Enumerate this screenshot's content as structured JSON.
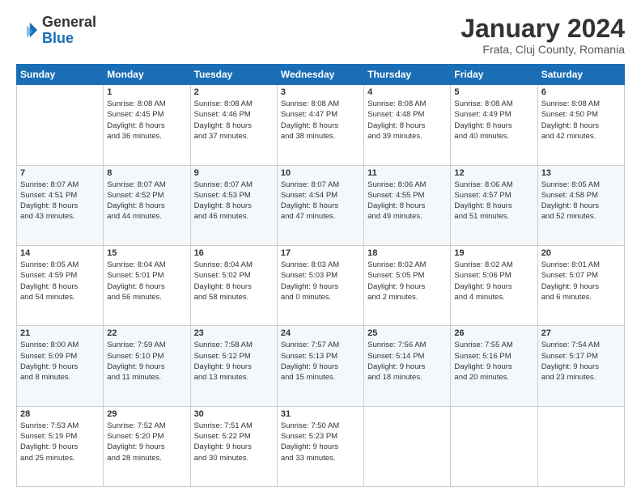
{
  "logo": {
    "line1": "General",
    "line2": "Blue"
  },
  "title": "January 2024",
  "subtitle": "Frata, Cluj County, Romania",
  "days_header": [
    "Sunday",
    "Monday",
    "Tuesday",
    "Wednesday",
    "Thursday",
    "Friday",
    "Saturday"
  ],
  "weeks": [
    [
      {
        "day": "",
        "content": ""
      },
      {
        "day": "1",
        "content": "Sunrise: 8:08 AM\nSunset: 4:45 PM\nDaylight: 8 hours\nand 36 minutes."
      },
      {
        "day": "2",
        "content": "Sunrise: 8:08 AM\nSunset: 4:46 PM\nDaylight: 8 hours\nand 37 minutes."
      },
      {
        "day": "3",
        "content": "Sunrise: 8:08 AM\nSunset: 4:47 PM\nDaylight: 8 hours\nand 38 minutes."
      },
      {
        "day": "4",
        "content": "Sunrise: 8:08 AM\nSunset: 4:48 PM\nDaylight: 8 hours\nand 39 minutes."
      },
      {
        "day": "5",
        "content": "Sunrise: 8:08 AM\nSunset: 4:49 PM\nDaylight: 8 hours\nand 40 minutes."
      },
      {
        "day": "6",
        "content": "Sunrise: 8:08 AM\nSunset: 4:50 PM\nDaylight: 8 hours\nand 42 minutes."
      }
    ],
    [
      {
        "day": "7",
        "content": "Sunrise: 8:07 AM\nSunset: 4:51 PM\nDaylight: 8 hours\nand 43 minutes."
      },
      {
        "day": "8",
        "content": "Sunrise: 8:07 AM\nSunset: 4:52 PM\nDaylight: 8 hours\nand 44 minutes."
      },
      {
        "day": "9",
        "content": "Sunrise: 8:07 AM\nSunset: 4:53 PM\nDaylight: 8 hours\nand 46 minutes."
      },
      {
        "day": "10",
        "content": "Sunrise: 8:07 AM\nSunset: 4:54 PM\nDaylight: 8 hours\nand 47 minutes."
      },
      {
        "day": "11",
        "content": "Sunrise: 8:06 AM\nSunset: 4:55 PM\nDaylight: 8 hours\nand 49 minutes."
      },
      {
        "day": "12",
        "content": "Sunrise: 8:06 AM\nSunset: 4:57 PM\nDaylight: 8 hours\nand 51 minutes."
      },
      {
        "day": "13",
        "content": "Sunrise: 8:05 AM\nSunset: 4:58 PM\nDaylight: 8 hours\nand 52 minutes."
      }
    ],
    [
      {
        "day": "14",
        "content": "Sunrise: 8:05 AM\nSunset: 4:59 PM\nDaylight: 8 hours\nand 54 minutes."
      },
      {
        "day": "15",
        "content": "Sunrise: 8:04 AM\nSunset: 5:01 PM\nDaylight: 8 hours\nand 56 minutes."
      },
      {
        "day": "16",
        "content": "Sunrise: 8:04 AM\nSunset: 5:02 PM\nDaylight: 8 hours\nand 58 minutes."
      },
      {
        "day": "17",
        "content": "Sunrise: 8:03 AM\nSunset: 5:03 PM\nDaylight: 9 hours\nand 0 minutes."
      },
      {
        "day": "18",
        "content": "Sunrise: 8:02 AM\nSunset: 5:05 PM\nDaylight: 9 hours\nand 2 minutes."
      },
      {
        "day": "19",
        "content": "Sunrise: 8:02 AM\nSunset: 5:06 PM\nDaylight: 9 hours\nand 4 minutes."
      },
      {
        "day": "20",
        "content": "Sunrise: 8:01 AM\nSunset: 5:07 PM\nDaylight: 9 hours\nand 6 minutes."
      }
    ],
    [
      {
        "day": "21",
        "content": "Sunrise: 8:00 AM\nSunset: 5:09 PM\nDaylight: 9 hours\nand 8 minutes."
      },
      {
        "day": "22",
        "content": "Sunrise: 7:59 AM\nSunset: 5:10 PM\nDaylight: 9 hours\nand 11 minutes."
      },
      {
        "day": "23",
        "content": "Sunrise: 7:58 AM\nSunset: 5:12 PM\nDaylight: 9 hours\nand 13 minutes."
      },
      {
        "day": "24",
        "content": "Sunrise: 7:57 AM\nSunset: 5:13 PM\nDaylight: 9 hours\nand 15 minutes."
      },
      {
        "day": "25",
        "content": "Sunrise: 7:56 AM\nSunset: 5:14 PM\nDaylight: 9 hours\nand 18 minutes."
      },
      {
        "day": "26",
        "content": "Sunrise: 7:55 AM\nSunset: 5:16 PM\nDaylight: 9 hours\nand 20 minutes."
      },
      {
        "day": "27",
        "content": "Sunrise: 7:54 AM\nSunset: 5:17 PM\nDaylight: 9 hours\nand 23 minutes."
      }
    ],
    [
      {
        "day": "28",
        "content": "Sunrise: 7:53 AM\nSunset: 5:19 PM\nDaylight: 9 hours\nand 25 minutes."
      },
      {
        "day": "29",
        "content": "Sunrise: 7:52 AM\nSunset: 5:20 PM\nDaylight: 9 hours\nand 28 minutes."
      },
      {
        "day": "30",
        "content": "Sunrise: 7:51 AM\nSunset: 5:22 PM\nDaylight: 9 hours\nand 30 minutes."
      },
      {
        "day": "31",
        "content": "Sunrise: 7:50 AM\nSunset: 5:23 PM\nDaylight: 9 hours\nand 33 minutes."
      },
      {
        "day": "",
        "content": ""
      },
      {
        "day": "",
        "content": ""
      },
      {
        "day": "",
        "content": ""
      }
    ]
  ]
}
